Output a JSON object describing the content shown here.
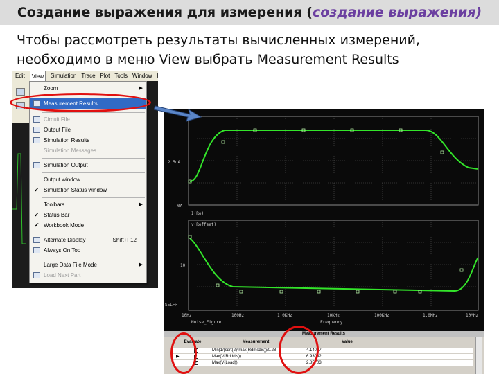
{
  "slide": {
    "title_main": "Создание выражения для измерения (",
    "title_accent": "создание выражения)",
    "body_line1": "Чтобы рассмотреть результаты вычисленных измерений,",
    "body_line2": "необходимо в меню View выбрать Measurement Results"
  },
  "menubar": [
    "Edit",
    "View",
    "Simulation",
    "Trace",
    "Plot",
    "Tools",
    "Window",
    "He"
  ],
  "menu_items": [
    {
      "label": "Zoom",
      "submenu": true
    },
    {
      "label": "Measurement Results",
      "highlighted": true
    },
    {
      "label": "Circuit File",
      "disabled": true
    },
    {
      "label": "Output File"
    },
    {
      "label": "Simulation Results"
    },
    {
      "label": "Simulation Messages",
      "disabled": true
    },
    {
      "label": "Simulation Output"
    },
    {
      "label": "Output window"
    },
    {
      "label": "Simulation Status window",
      "checked": true
    },
    {
      "label": "Toolbars...",
      "submenu": true
    },
    {
      "label": "Status Bar",
      "checked": true
    },
    {
      "label": "Workbook Mode",
      "checked": true
    },
    {
      "label": "Alternate Display",
      "shortcut": "Shift+F12"
    },
    {
      "label": "Always On Top"
    },
    {
      "label": "Large Data File Mode",
      "submenu": true
    },
    {
      "label": "Load Next Part",
      "disabled": true
    }
  ],
  "plot": {
    "top_y_labels": [
      "2.5uA",
      "0A"
    ],
    "bottom_y_labels": [
      "10",
      "SEL>>"
    ],
    "top_trace_label": "I(Ro)",
    "bottom_legend": "v(Roffset)",
    "x_tick_labels": [
      "10Hz",
      "100Hz",
      "1.0KHz",
      "10KHz",
      "100KHz",
      "1.0MHz",
      "10MHz"
    ],
    "x_axis_label": "Frequency",
    "bottom_trace_label": "Noise_Figure",
    "colors": {
      "trace": "#33e52a",
      "grid": "#6a6a6a",
      "background": "#0a0a0a"
    }
  },
  "measurement": {
    "window_title": "Measurement Results",
    "headers": {
      "evaluate": "Evaluate",
      "measurement": "Measurement",
      "value": "Value"
    },
    "rows": [
      {
        "expr": "Min(1/(sqrt(2)*max(Rdmsdis))/0.28",
        "value": "4.14007",
        "checked": true
      },
      {
        "expr": "Max(V(Rdddis))",
        "value": "6.93032",
        "checked": true
      },
      {
        "expr": "Max(V(Load))",
        "value": "2.85703",
        "checked": true
      }
    ]
  }
}
